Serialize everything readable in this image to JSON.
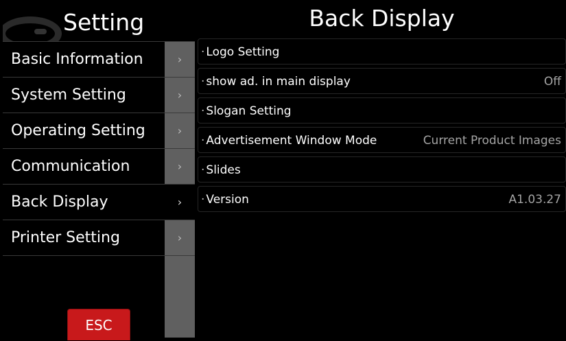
{
  "sidebar": {
    "title": "Setting",
    "items": [
      {
        "label": "Basic Information",
        "arrow": "›"
      },
      {
        "label": "System Setting",
        "arrow": "›"
      },
      {
        "label": "Operating Setting",
        "arrow": "›"
      },
      {
        "label": "Communication",
        "arrow": "›"
      },
      {
        "label": "Back Display",
        "arrow": "›"
      },
      {
        "label": "Printer Setting",
        "arrow": "›"
      }
    ],
    "active_item": "Back Display",
    "esc_label": "ESC"
  },
  "panel": {
    "title": "Back Display",
    "bullet": "·",
    "settings": [
      {
        "label": "Logo Setting",
        "value": ""
      },
      {
        "label": "show ad. in main display",
        "value": "Off"
      },
      {
        "label": "Slogan Setting",
        "value": ""
      },
      {
        "label": "Advertisement Window Mode",
        "value": "Current Product Images"
      },
      {
        "label": "Slides",
        "value": ""
      },
      {
        "label": "Version",
        "value": "A1.03.27"
      }
    ]
  },
  "colors": {
    "background": "#000000",
    "sidebar_arrow_column": "#606060",
    "esc_button": "#c8191b",
    "value_text": "#a5a5a5"
  },
  "icons": {
    "chevron": "chevron-right-icon",
    "logo": "brand-logo-icon"
  }
}
